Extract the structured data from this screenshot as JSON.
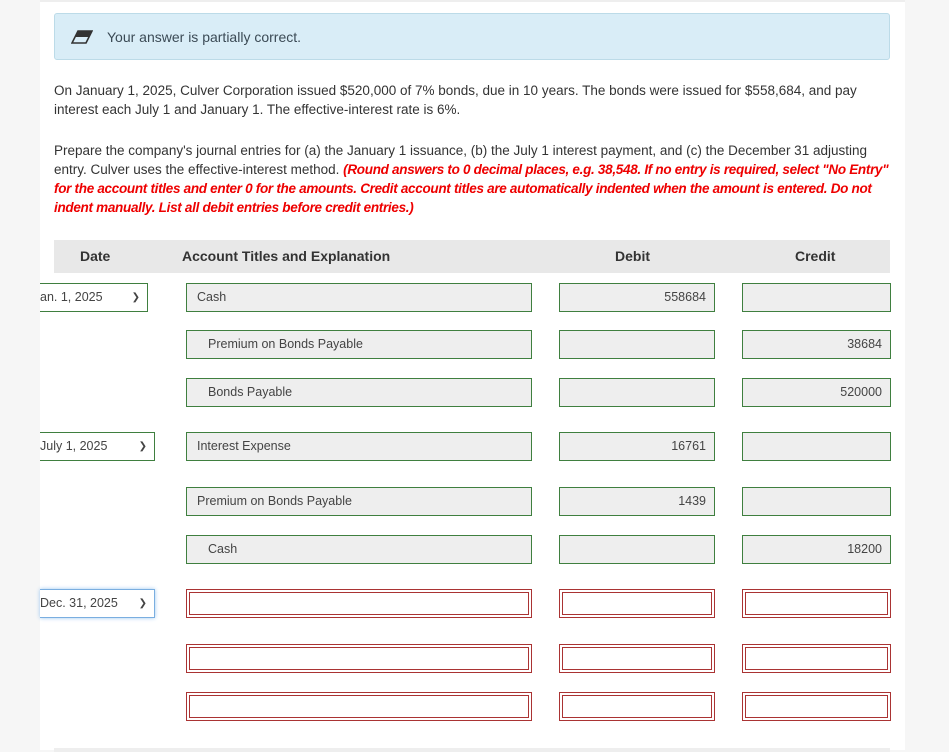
{
  "banner": {
    "text": "Your answer is partially correct.",
    "icon": "eraser-icon"
  },
  "problem": "On January 1, 2025, Culver Corporation issued $520,000 of 7% bonds, due in 10 years. The bonds were issued for $558,684, and pay interest each July 1 and January 1. The effective-interest rate is 6%.",
  "instructions": "Prepare the company's journal entries for (a) the January 1 issuance, (b) the July 1 interest payment, and (c) the December 31 adjusting entry. Culver uses the effective-interest method.",
  "instructions_red": "(Round answers to 0 decimal places, e.g. 38,548. If no entry is required, select \"No Entry\" for the account titles and enter 0 for the amounts. Credit account titles are automatically indented when the amount is entered. Do not indent manually. List all debit entries before credit entries.)",
  "table": {
    "headers": {
      "date": "Date",
      "account": "Account Titles and Explanation",
      "debit": "Debit",
      "credit": "Credit"
    },
    "rows": [
      {
        "date": "an. 1, 2025",
        "account": "Cash",
        "debit": "558684",
        "credit": ""
      },
      {
        "date": "",
        "account": "Premium on Bonds Payable",
        "debit": "",
        "credit": "38684"
      },
      {
        "date": "",
        "account": "Bonds Payable",
        "debit": "",
        "credit": "520000"
      },
      {
        "date": "July 1, 2025",
        "account": "Interest Expense",
        "debit": "16761",
        "credit": ""
      },
      {
        "date": "",
        "account": "Premium on Bonds Payable",
        "debit": "1439",
        "credit": ""
      },
      {
        "date": "",
        "account": "Cash",
        "debit": "",
        "credit": "18200"
      },
      {
        "date": "Dec. 31, 2025",
        "account": "",
        "debit": "",
        "credit": ""
      },
      {
        "date": "",
        "account": "",
        "debit": "",
        "credit": ""
      },
      {
        "date": "",
        "account": "",
        "debit": "",
        "credit": ""
      }
    ]
  }
}
